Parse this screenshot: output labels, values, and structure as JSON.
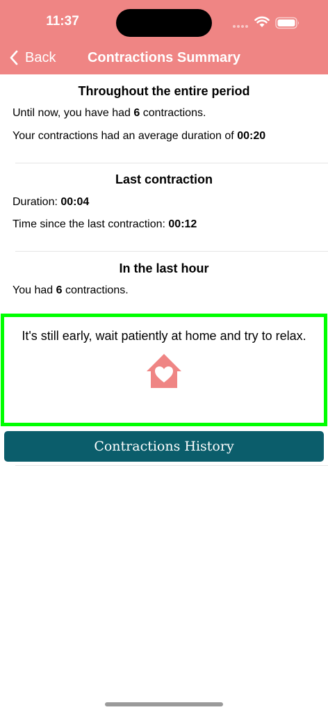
{
  "status_bar": {
    "time": "11:37"
  },
  "nav": {
    "back_label": "Back",
    "title": "Contractions Summary"
  },
  "entire_period": {
    "title": "Throughout the entire period",
    "count_prefix": "Until now, you have had ",
    "count_value": "6",
    "count_suffix": " contractions.",
    "avg_prefix": "Your contractions had an average duration of ",
    "avg_value": "00:20"
  },
  "last_contraction": {
    "title": "Last contraction",
    "duration_prefix": "Duration: ",
    "duration_value": "00:04",
    "since_prefix": "Time since the last contraction: ",
    "since_value": "00:12"
  },
  "last_hour": {
    "title": "In the last hour",
    "count_prefix": "You had ",
    "count_value": "6",
    "count_suffix": " contractions."
  },
  "message": {
    "text": "It's still early, wait patiently at home and try to relax.",
    "icon": "home-heart-icon"
  },
  "history_button": {
    "label": "Contractions History"
  },
  "colors": {
    "header_bg": "#ef8584",
    "icon_color": "#ef8584",
    "button_bg": "#0b5d6b",
    "highlight_border": "#00ff00"
  }
}
